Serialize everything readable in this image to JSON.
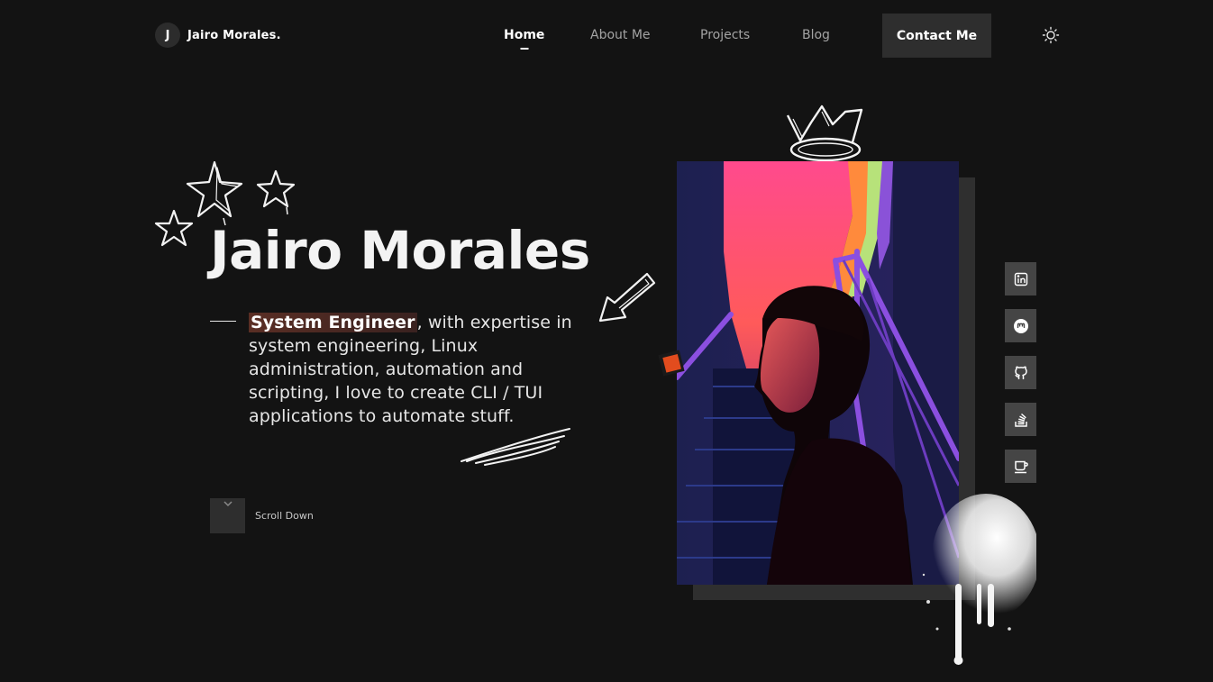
{
  "header": {
    "logo_initial": "J",
    "logo_text": "Jairo Morales.",
    "nav": [
      {
        "label": "Home",
        "active": true
      },
      {
        "label": "About Me",
        "active": false
      },
      {
        "label": "Projects",
        "active": false
      },
      {
        "label": "Blog",
        "active": false
      }
    ],
    "contact_label": "Contact Me",
    "theme_icon": "sun-icon"
  },
  "hero": {
    "name": "Jairo Morales",
    "role": "System Engineer",
    "description": ", with expertise in system engineering, Linux administration, automation and scripting, I love to create CLI / TUI applications to automate stuff.",
    "scroll_label": "Scroll Down"
  },
  "social": [
    {
      "icon": "linkedin-icon"
    },
    {
      "icon": "mastodon-icon"
    },
    {
      "icon": "github-icon"
    },
    {
      "icon": "stackoverflow-icon"
    },
    {
      "icon": "coffee-icon"
    }
  ],
  "colors": {
    "background": "#131313",
    "button_bg": "#2e2e2e",
    "social_bg": "#454545",
    "accent_orange": "#e24c1e",
    "highlight": "#5a2e24"
  }
}
